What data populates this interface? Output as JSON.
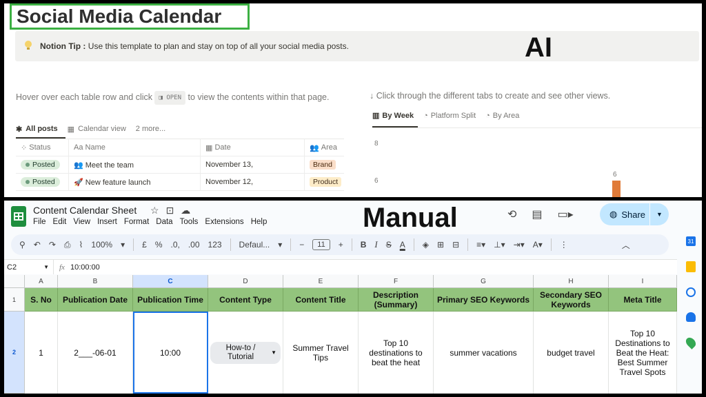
{
  "top": {
    "title": "Social Media Calendar",
    "tip_bold": "Notion Tip :",
    "tip_text": " Use this template to plan and stay on top of all your social media posts.",
    "ai_label": "AI",
    "hover_before": "Hover over each table row and click ",
    "open_chip": "◨ OPEN",
    "hover_after": " to view the contents within that page.",
    "click_text": "↓ Click through the different tabs to create and see other views.",
    "views": [
      {
        "icon": "✱",
        "label": "All posts"
      },
      {
        "icon": "▦",
        "label": "Calendar view"
      },
      {
        "icon": "",
        "label": "2 more..."
      }
    ],
    "table": {
      "headers": [
        {
          "icon": "⁘",
          "label": "Status"
        },
        {
          "icon": "Aa",
          "label": "Name"
        },
        {
          "icon": "▦",
          "label": "Date"
        },
        {
          "icon": "👥",
          "label": "Area"
        }
      ],
      "rows": [
        {
          "status": "Posted",
          "name": "👥 Meet the team",
          "date": "November 13,",
          "area": "Brand"
        },
        {
          "status": "Posted",
          "name": "🚀 New feature launch",
          "date": "November 12,",
          "area": "Product"
        }
      ]
    },
    "chart_tabs": [
      {
        "icon": "▥",
        "label": "By Week"
      },
      {
        "icon": "◔",
        "label": "Platform Split"
      },
      {
        "icon": "◔",
        "label": "By Area"
      }
    ],
    "y_ticks": [
      "8",
      "6"
    ],
    "bar_label": "6"
  },
  "bottom": {
    "doc_title": "Content Calendar Sheet",
    "menus": [
      "File",
      "Edit",
      "View",
      "Insert",
      "Format",
      "Data",
      "Tools",
      "Extensions",
      "Help"
    ],
    "manual_label": "Manual",
    "share_label": "Share",
    "toolbar": {
      "zoom": "100%",
      "currency": "£",
      "percent": "%",
      "dec_decrease": ".0,",
      "dec_increase": ".00",
      "number_format": "123",
      "font": "Defaul...",
      "font_size": "11",
      "bold": "B",
      "italic": "I",
      "strike": "S",
      "text_color": "A"
    },
    "formula": {
      "cell_ref": "C2",
      "fx": "fx",
      "value": "10:00:00"
    },
    "columns": [
      "A",
      "B",
      "C",
      "D",
      "E",
      "F",
      "G",
      "H",
      "I"
    ],
    "rows": [
      "1",
      "2"
    ],
    "headers": [
      "S. No",
      "Publication Date",
      "Publication Time",
      "Content Type",
      "Content Title",
      "Description (Summary)",
      "Primary SEO Keywords",
      "Secondary SEO Keywords",
      "Meta Title"
    ],
    "row2": {
      "s_no": "1",
      "pub_date": "2___-06-01",
      "pub_time": "10:00",
      "content_type": "How-to / Tutorial",
      "content_title": "Summer Travel Tips",
      "description": "Top 10 destinations to beat the heat",
      "primary_seo": "summer vacations",
      "secondary_seo": "budget travel",
      "meta_title": "Top 10 Destinations to Beat the Heat: Best Summer Travel Spots"
    },
    "sidebar_cal": "31"
  }
}
